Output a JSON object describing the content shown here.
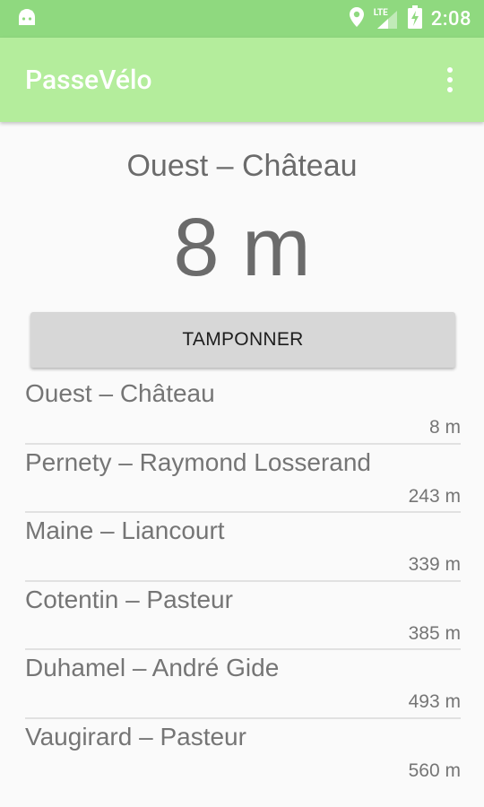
{
  "status_bar": {
    "time": "2:08",
    "network_label": "LTE",
    "icons": [
      "android-icon",
      "location-icon",
      "signal-icon",
      "battery-charging-icon"
    ]
  },
  "app_bar": {
    "title": "PasseVélo",
    "menu_icon": "overflow-menu-icon"
  },
  "current": {
    "station": "Ouest – Château",
    "distance": "8 m"
  },
  "actions": {
    "stamp_label": "TAMPONNER"
  },
  "stations": [
    {
      "name": "Ouest – Château",
      "distance": "8 m"
    },
    {
      "name": "Pernety – Raymond Losserand",
      "distance": "243 m"
    },
    {
      "name": "Maine – Liancourt",
      "distance": "339 m"
    },
    {
      "name": "Cotentin – Pasteur",
      "distance": "385 m"
    },
    {
      "name": "Duhamel – André Gide",
      "distance": "493 m"
    },
    {
      "name": "Vaugirard – Pasteur",
      "distance": "560 m"
    }
  ],
  "colors": {
    "status_bar": "#8fd97f",
    "app_bar": "#b4ed9c",
    "background": "#fafafa",
    "button": "#d7d7d7",
    "text": "#757575"
  }
}
